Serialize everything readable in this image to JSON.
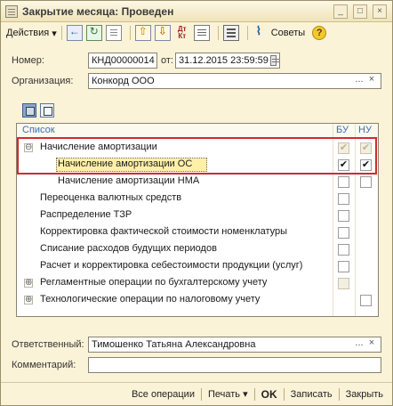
{
  "window": {
    "title": "Закрытие месяца: Проведен",
    "buttons": {
      "minimize": "_",
      "maximize": "□",
      "close": "×"
    }
  },
  "toolbar": {
    "actions_label": "Действия",
    "sovety_label": "Советы",
    "dtkt_label": "Дт\nКт",
    "help_label": "?"
  },
  "form": {
    "number_label": "Номер:",
    "number_value": "КНД00000014",
    "date_label": "от:",
    "date_value": "31.12.2015 23:59:59",
    "org_label": "Организация:",
    "org_value": "Конкорд ООО",
    "responsible_label": "Ответственный:",
    "responsible_value": "Тимошенко Татьяна Александровна",
    "comment_label": "Комментарий:",
    "comment_value": ""
  },
  "table": {
    "headers": {
      "list": "Список",
      "bu": "БУ",
      "nu": "НУ"
    },
    "rows": [
      {
        "label": "Начисление амортизации",
        "expander": "⊖",
        "bu": "✔",
        "nu": "✔",
        "bu_state": "disabled",
        "nu_state": "disabled"
      },
      {
        "label": "Начисление амортизации ОС",
        "bu": "✔",
        "nu": "✔",
        "bu_state": "enabled",
        "nu_state": "enabled"
      },
      {
        "label": "Начисление амортизации НМА",
        "bu": "",
        "nu": "",
        "bu_state": "enabled",
        "nu_state": "enabled"
      },
      {
        "label": "Переоценка валютных средств",
        "bu": "",
        "nu": "",
        "bu_state": "enabled",
        "nu_state": "none"
      },
      {
        "label": "Распределение ТЗР",
        "bu": "",
        "nu": "",
        "bu_state": "enabled",
        "nu_state": "none"
      },
      {
        "label": "Корректировка фактической стоимости номенклатуры",
        "bu": "",
        "nu": "",
        "bu_state": "enabled",
        "nu_state": "none"
      },
      {
        "label": "Списание расходов будущих периодов",
        "bu": "",
        "nu": "",
        "bu_state": "enabled",
        "nu_state": "none"
      },
      {
        "label": "Расчет и корректировка себестоимости продукции (услуг)",
        "bu": "",
        "nu": "",
        "bu_state": "enabled",
        "nu_state": "none"
      },
      {
        "label": "Регламентные операции по бухгалтерскому учету",
        "expander": "⊕",
        "bu": "",
        "nu": "",
        "bu_state": "disabled",
        "nu_state": "none"
      },
      {
        "label": "Технологические операции по налоговому учету",
        "expander": "⊕",
        "bu": "",
        "nu": "",
        "bu_state": "none",
        "nu_state": "enabled"
      }
    ]
  },
  "bottom": {
    "all_ops": "Все операции",
    "print": "Печать",
    "ok": "OK",
    "save": "Записать",
    "close": "Закрыть"
  },
  "icons": {
    "title": "document-icon",
    "help": "help-icon",
    "sovety": "tips-icon"
  },
  "colors": {
    "highlight_red": "#d22b2b",
    "selection_yellow": "#fff0a8",
    "header_blue": "#3f6db2"
  }
}
